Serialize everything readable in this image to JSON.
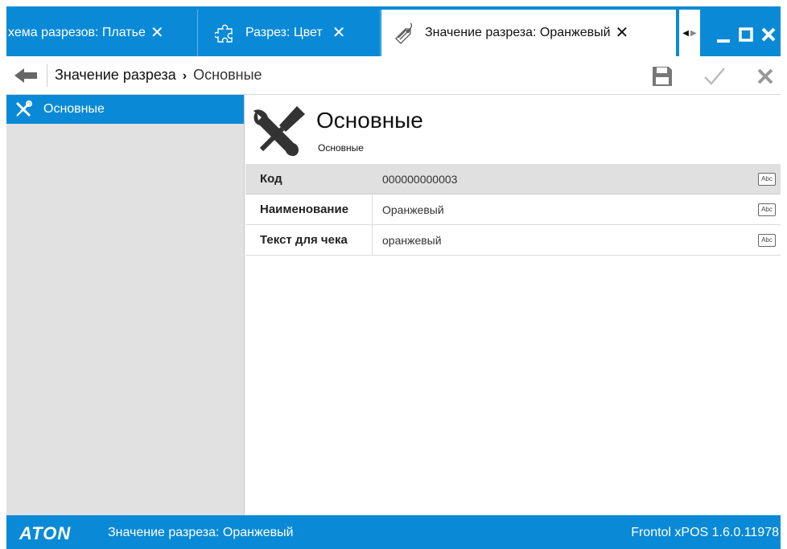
{
  "tabs": [
    {
      "label": "хема разрезов: Платье",
      "close": "✕",
      "icon": "none"
    },
    {
      "label": "Разрез: Цвет",
      "close": "✕",
      "icon": "puzzle-icon"
    },
    {
      "label": "Значение разреза: Оранжевый",
      "close": "✕",
      "icon": "tag-icon",
      "active": true
    }
  ],
  "tab_scroll": {
    "left": "◀",
    "right": "▶"
  },
  "window_controls": {
    "minimize": "_",
    "maximize": "□",
    "close": "✕"
  },
  "toolbar": {
    "breadcrumb_parent": "Значение разреза",
    "breadcrumb_separator": "›",
    "breadcrumb_current": "Основные"
  },
  "sidebar": {
    "items": [
      {
        "label": "Основные",
        "icon": "tools-icon",
        "selected": true
      }
    ]
  },
  "section": {
    "title": "Основные",
    "subtitle": "Основные"
  },
  "fields": [
    {
      "label": "Код",
      "value": "000000000003",
      "badge": "Abc"
    },
    {
      "label": "Наименование",
      "value": "Оранжевый",
      "badge": "Abc"
    },
    {
      "label": "Текст для чека",
      "value": "оранжевый",
      "badge": "Abc"
    }
  ],
  "statusbar": {
    "logo": "ATON",
    "text": "Значение разреза: Оранжевый",
    "version": "Frontol xPOS 1.6.0.11978"
  },
  "colors": {
    "accent": "#0a8ad6",
    "sidebar_bg": "#e1e1e1",
    "active_row": "#e0e0e0"
  }
}
